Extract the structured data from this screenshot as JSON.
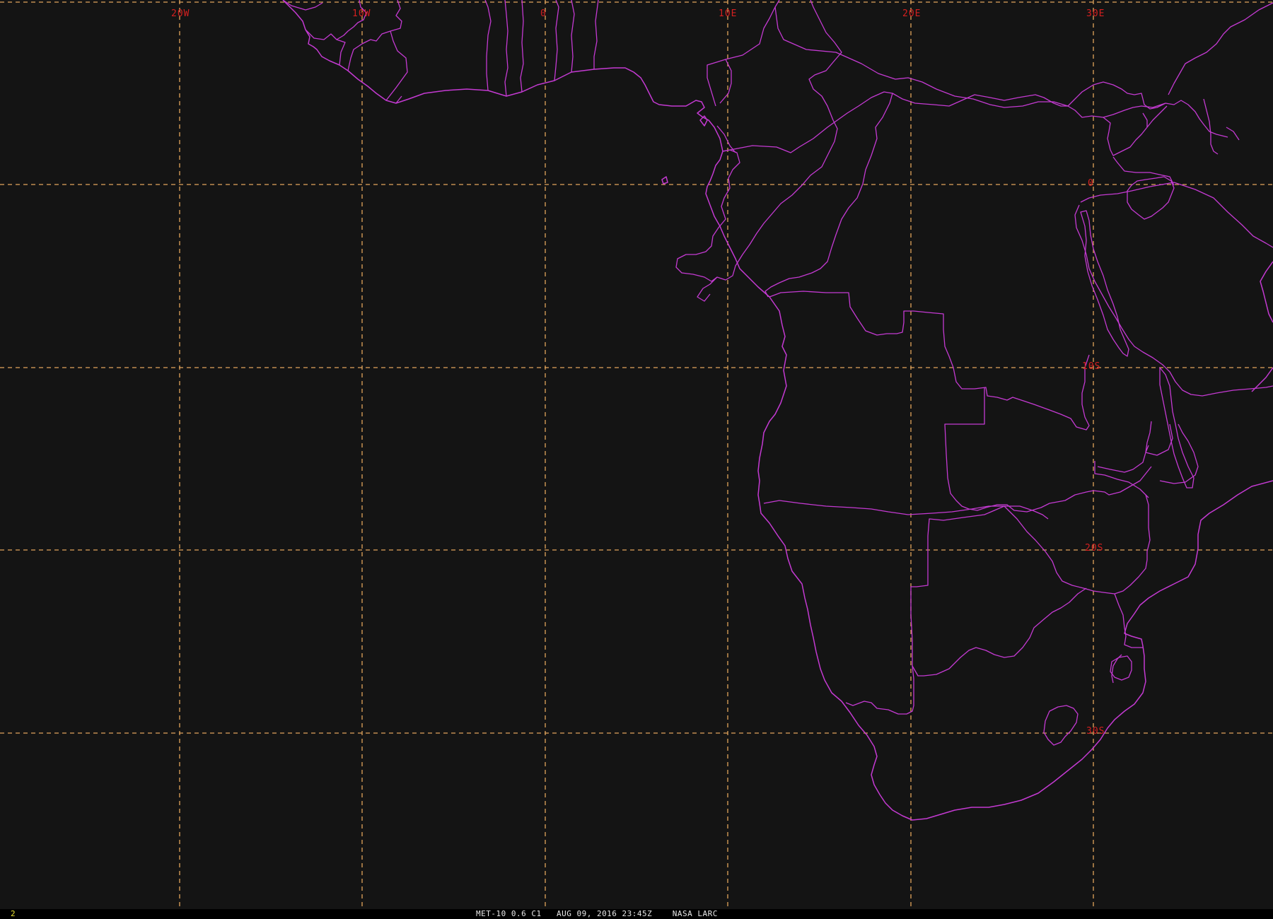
{
  "map": {
    "background_color": "#141414",
    "gridline_color": "#e2a55c",
    "boundary_color": "#c43ad2",
    "label_color": "#d42020",
    "longitude_labels": [
      "20W",
      "10W",
      "0",
      "10E",
      "20E",
      "30E"
    ],
    "latitude_labels": [
      "0",
      "10S",
      "20S",
      "30S"
    ]
  },
  "footer": {
    "frame_number": "2",
    "caption": "MET-10 0.6 C1   AUG 09, 2016 23:45Z    NASA LARC"
  }
}
